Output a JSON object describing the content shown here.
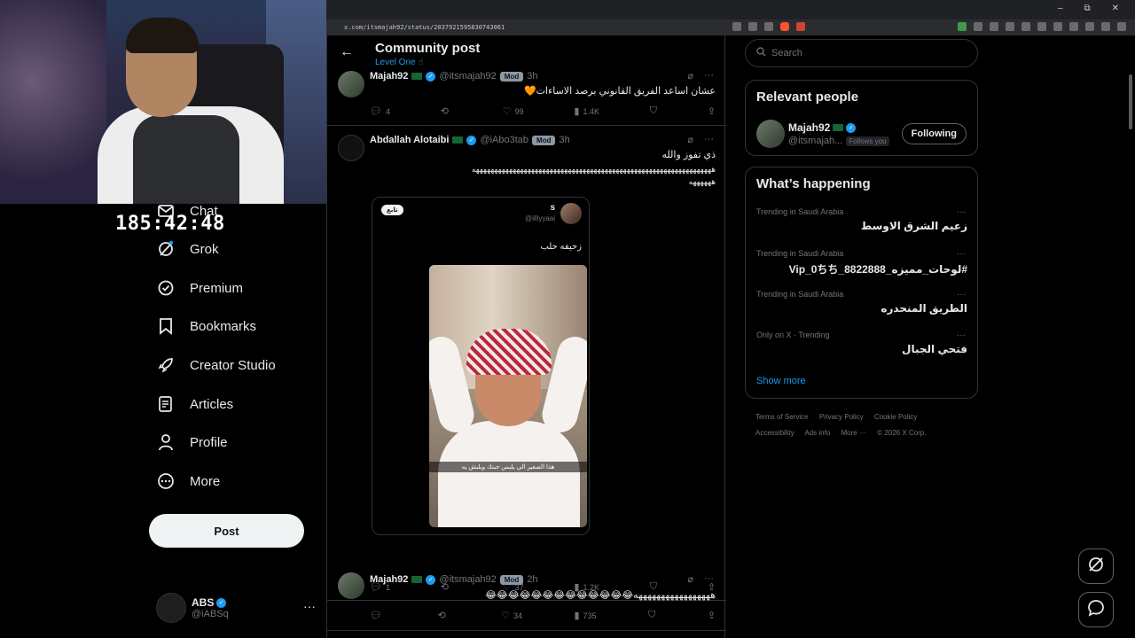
{
  "browser": {
    "url": "x.com/itsmajah92/status/2037921595830743061",
    "window_buttons": [
      "–",
      "⧉",
      "✕"
    ]
  },
  "stream": {
    "timer": "185:42:48"
  },
  "sidebar": {
    "items": [
      {
        "label": "Chat",
        "icon": "mail-icon"
      },
      {
        "label": "Grok",
        "icon": "grok-icon"
      },
      {
        "label": "Premium",
        "icon": "premium-icon"
      },
      {
        "label": "Bookmarks",
        "icon": "bookmark-icon"
      },
      {
        "label": "Creator Studio",
        "icon": "rocket-icon"
      },
      {
        "label": "Articles",
        "icon": "article-icon"
      },
      {
        "label": "Profile",
        "icon": "person-icon"
      },
      {
        "label": "More",
        "icon": "more-circle-icon"
      }
    ],
    "post_button": "Post",
    "account": {
      "name": "ABS",
      "handle": "@iABSq",
      "more": "···"
    }
  },
  "header": {
    "title": "Community post",
    "subtitle": "Level One ☝"
  },
  "posts": [
    {
      "name": "Majah92",
      "handle": "@itsmajah92",
      "badge": "Mod",
      "time": "3h",
      "text": "عشان اساعد الفريق القانوني برصد الاساءات🧡",
      "actions": {
        "replies": "4",
        "reposts": "",
        "likes": "99",
        "views": "1.4K"
      }
    },
    {
      "name": "Abdallah Alotaibi",
      "handle": "@iAbo3tab",
      "badge": "Mod",
      "time": "3h",
      "text": "ذي تفوز والله",
      "text2": "هههههههههههههههههههههههههههههههههههههههههههههههههههههههههههههههههه",
      "text3": "ههههههه",
      "quote": {
        "follow": "تابع",
        "name": "s",
        "handle": "@illlyyaai",
        "text": "زحيفه حلب",
        "caption": "هذا الصغير الي يلبس جبنك ويلبش يه"
      },
      "actions": {
        "replies": "1",
        "reposts": "",
        "likes": "37",
        "views": "1.2K"
      }
    },
    {
      "name": "Majah92",
      "handle": "@itsmajah92",
      "badge": "Mod",
      "time": "2h",
      "text": "هههههههههههههههههه😂😂😂😂😂😂😂😂😂😂😂😂😂",
      "actions": {
        "replies": "",
        "reposts": "",
        "likes": "34",
        "views": "735"
      }
    }
  ],
  "right": {
    "search_placeholder": "Search",
    "relevant_title": "Relevant people",
    "person": {
      "name": "Majah92",
      "handle": "@itsmajah...",
      "follows_you": "Follows you",
      "button": "Following"
    },
    "happening_title": "What’s happening",
    "trends": [
      {
        "meta": "Trending in Saudi Arabia",
        "title": "زعيم الشرق الاوسط"
      },
      {
        "meta": "Trending in Saudi Arabia",
        "title": "#لوحات_مميزه_8822888_Vip_0ちち"
      },
      {
        "meta": "Trending in Saudi Arabia",
        "title": "الطريق المنحدره"
      },
      {
        "meta": "Only on X · Trending",
        "title": "فتحي الجبال"
      }
    ],
    "show_more": "Show more",
    "footer": [
      "Terms of Service",
      "Privacy Policy",
      "Cookie Policy",
      "Accessibility",
      "Ads info",
      "More ···",
      "© 2026 X Corp."
    ]
  }
}
